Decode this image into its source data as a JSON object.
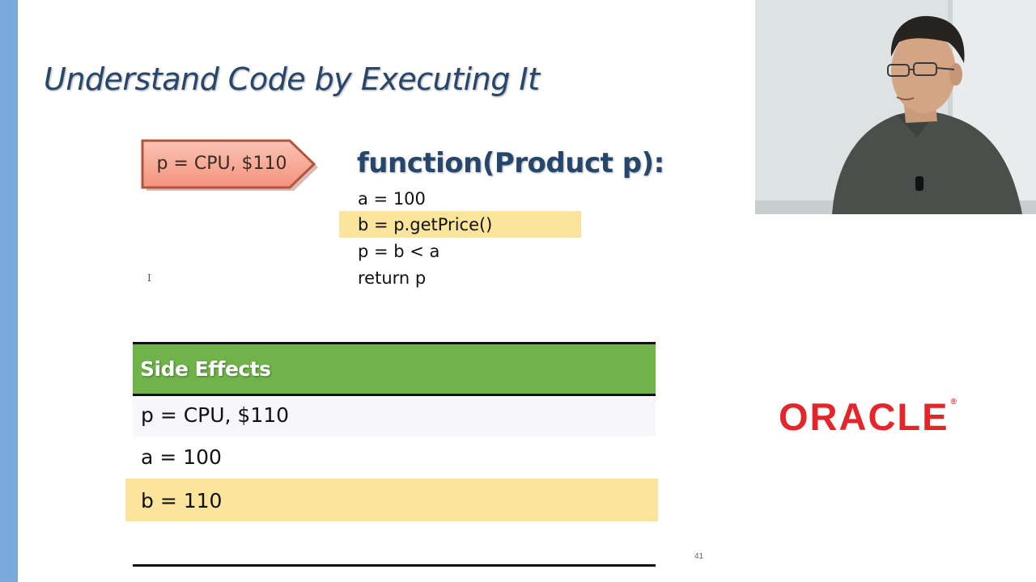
{
  "slide": {
    "title": "Understand Code by Executing It",
    "arrow_tag_label": "p = CPU, $110",
    "function_header": "function(Product p):",
    "code_lines": [
      "a = 100",
      "b = p.getPrice()",
      "p = b < a",
      "return p"
    ],
    "highlighted_code_line_index": 1,
    "side_effects": {
      "header": "Side Effects",
      "rows": [
        "p = CPU, $110",
        "a = 100",
        "b = 110"
      ],
      "highlighted_row_index": 2
    },
    "page_number": "41"
  },
  "logo": {
    "text": "ORACLE",
    "mark": "®"
  },
  "colors": {
    "title": "#27466b",
    "accent_bar": "#7aa9dd",
    "arrow_fill": "#f7a895",
    "arrow_border": "#b2553c",
    "highlight": "#fbe49b",
    "table_header": "#6fb34a",
    "logo": "#e3262b"
  }
}
